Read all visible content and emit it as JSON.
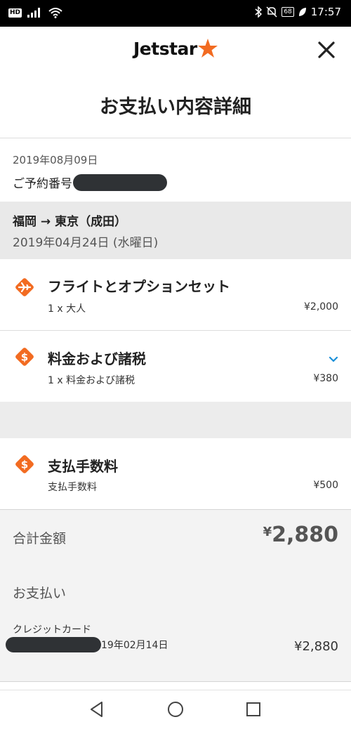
{
  "status_bar": {
    "hd": "HD",
    "battery": "68",
    "time": "17:57",
    "icons": [
      "signal-icon",
      "wifi-icon",
      "bluetooth-icon",
      "mute-icon",
      "battery-icon",
      "leaf-icon"
    ]
  },
  "header": {
    "logo_text": "Jetstar",
    "title": "お支払い内容詳細",
    "icons": [
      "jetstar-star-icon",
      "close-icon"
    ]
  },
  "booking": {
    "date": "2019年08月09日",
    "ref_label": "ご予約番号"
  },
  "route": {
    "title": "福岡 → 東京（成田）",
    "date": "2019年04月24日 (水曜日)"
  },
  "items": [
    {
      "title": "フライトとオプションセット",
      "detail": "1 x 大人",
      "price": "¥2,000",
      "icon": "plane-tag-icon"
    },
    {
      "title": "料金および諸税",
      "detail": "1 x 料金および諸税",
      "price": "¥380",
      "icon": "dollar-tag-icon",
      "chevron": "chevron-down-icon"
    },
    {
      "title": "支払手数料",
      "detail": "支払手数料",
      "price": "¥500",
      "icon": "dollar-tag-icon"
    }
  ],
  "total": {
    "label": "合計金額",
    "currency": "¥",
    "amount": "2,880"
  },
  "payment": {
    "heading": "お支払い",
    "method": "クレジットカード",
    "date_suffix": "19年02月14日",
    "amount": "¥2,880"
  },
  "nav": {
    "icons": [
      "back-icon",
      "home-icon",
      "recents-icon"
    ]
  },
  "colors": {
    "accent": "#f26b21",
    "chevron": "#1a8fd8",
    "mask": "#2f3235",
    "route_bg": "#e9e9e9"
  }
}
